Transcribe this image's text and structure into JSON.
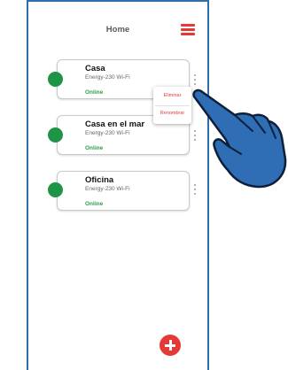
{
  "header": {
    "title": "Home"
  },
  "devices": [
    {
      "name": "Casa",
      "model": "Energy-230 Wi-Fi",
      "status": "Online"
    },
    {
      "name": "Casa en el mar",
      "model": "Energy-230 Wi-Fi",
      "status": "Online"
    },
    {
      "name": "Oficina",
      "model": "Energy-230 Wi-Fi",
      "status": "Online"
    }
  ],
  "context_menu": {
    "items": [
      "Eliminar",
      "Renombrar"
    ]
  },
  "colors": {
    "accent": "#e53935",
    "status_online": "#1e9447",
    "frame": "#2f6ea8",
    "hand": "#2f6db5"
  },
  "icons": {
    "menu": "hamburger-icon",
    "more": "kebab-menu-icon",
    "add": "plus-icon",
    "pointer": "hand-pointer-icon"
  }
}
